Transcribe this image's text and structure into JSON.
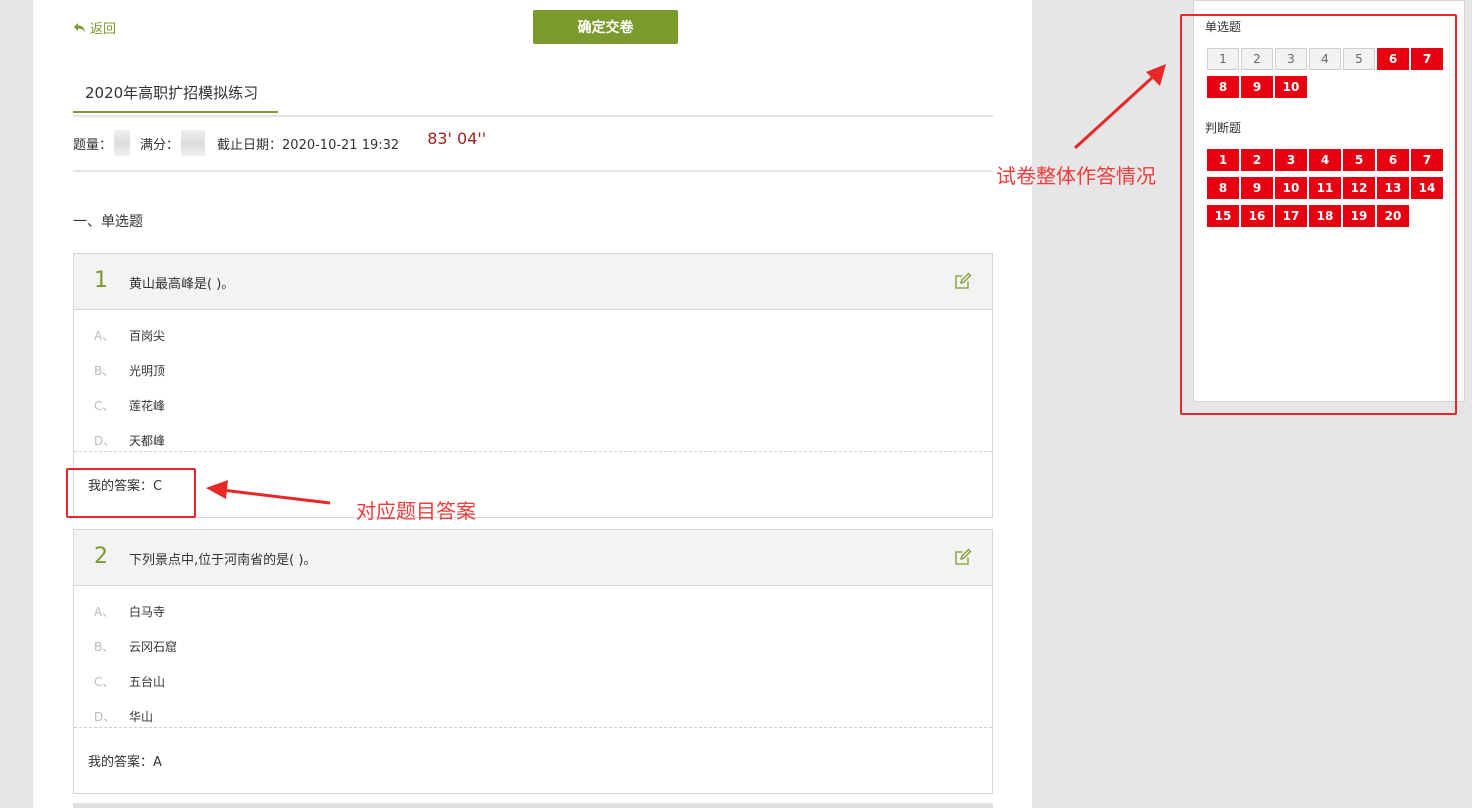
{
  "header": {
    "back_label": "返回",
    "submit_label": "确定交卷"
  },
  "exam": {
    "title": "2020年高职扩招模拟练习",
    "count_label": "题量：",
    "score_label": "满分：",
    "deadline": "截止日期：2020-10-21 19:32",
    "timer": "83' 04''"
  },
  "section": {
    "heading": "一、单选题"
  },
  "questions": [
    {
      "number": "1",
      "text": "黄山最高峰是( )。",
      "options": [
        {
          "letter": "A、",
          "text": "百岗尖"
        },
        {
          "letter": "B、",
          "text": "光明顶"
        },
        {
          "letter": "C、",
          "text": "莲花峰"
        },
        {
          "letter": "D、",
          "text": "天都峰"
        }
      ],
      "answer": "我的答案：C"
    },
    {
      "number": "2",
      "text": "下列景点中,位于河南省的是( )。",
      "options": [
        {
          "letter": "A、",
          "text": "白马寺"
        },
        {
          "letter": "B、",
          "text": "云冈石窟"
        },
        {
          "letter": "C、",
          "text": "五台山"
        },
        {
          "letter": "D、",
          "text": "华山"
        }
      ],
      "answer": "我的答案：A"
    }
  ],
  "panel": {
    "single_title": "单选题",
    "judge_title": "判断题",
    "single_items": [
      {
        "n": "1",
        "answered": false
      },
      {
        "n": "2",
        "answered": false
      },
      {
        "n": "3",
        "answered": false
      },
      {
        "n": "4",
        "answered": false
      },
      {
        "n": "5",
        "answered": false
      },
      {
        "n": "6",
        "answered": true
      },
      {
        "n": "7",
        "answered": true
      },
      {
        "n": "8",
        "answered": true
      },
      {
        "n": "9",
        "answered": true
      },
      {
        "n": "10",
        "answered": true
      }
    ],
    "judge_items": [
      {
        "n": "1",
        "answered": true
      },
      {
        "n": "2",
        "answered": true
      },
      {
        "n": "3",
        "answered": true
      },
      {
        "n": "4",
        "answered": true
      },
      {
        "n": "5",
        "answered": true
      },
      {
        "n": "6",
        "answered": true
      },
      {
        "n": "7",
        "answered": true
      },
      {
        "n": "8",
        "answered": true
      },
      {
        "n": "9",
        "answered": true
      },
      {
        "n": "10",
        "answered": true
      },
      {
        "n": "11",
        "answered": true
      },
      {
        "n": "12",
        "answered": true
      },
      {
        "n": "13",
        "answered": true
      },
      {
        "n": "14",
        "answered": true
      },
      {
        "n": "15",
        "answered": true
      },
      {
        "n": "16",
        "answered": true
      },
      {
        "n": "17",
        "answered": true
      },
      {
        "n": "18",
        "answered": true
      },
      {
        "n": "19",
        "answered": true
      },
      {
        "n": "20",
        "answered": true
      }
    ]
  },
  "annotations": {
    "answer_callout": "对应题目答案",
    "panel_callout": "试卷整体作答情况"
  },
  "colors": {
    "accent": "#7a9a2e",
    "answered": "#e60012",
    "annotation": "#e82828",
    "timer": "#a02020"
  }
}
